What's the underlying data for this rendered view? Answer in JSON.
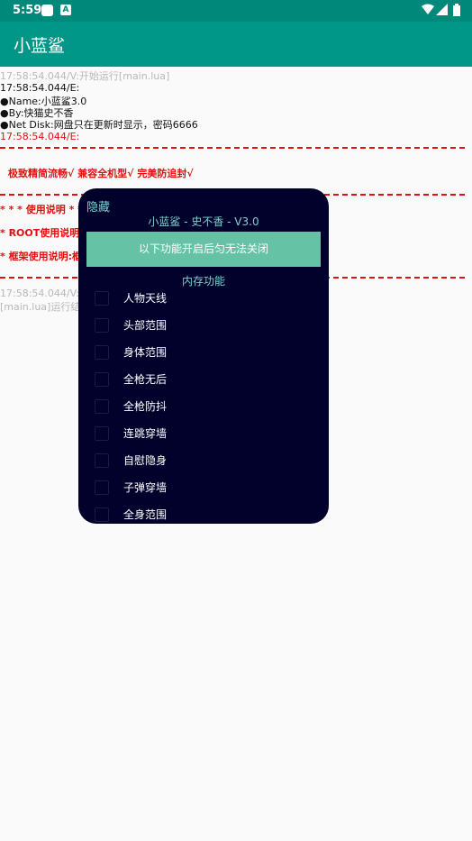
{
  "status_bar": {
    "time": "5:59",
    "icons": [
      "notification-square-icon",
      "a-icon",
      "wifi-icon",
      "signal-icon",
      "battery-icon"
    ]
  },
  "app": {
    "title": "小蓝鲨"
  },
  "log": {
    "l1": "17:58:54.044/V:开始运行[main.lua]",
    "l2": "17:58:54.044/E:",
    "l3": "●Name:小蓝鲨3.0",
    "l4": "●By:快猫史不香",
    "l5": "●Net Disk:网盘只在更新时显示，密码6666",
    "l6": "17:58:54.044/E:",
    "features": "极致精简流畅√  兼容全机型√  完美防追封√",
    "usage": "* * * 使用说明 * * *",
    "root": "* ROOT使用说明:编",
    "frame": "* 框架使用说明:框",
    "end1": "17:58:54.044/V:",
    "end2": "[main.lua]运行结束"
  },
  "menu": {
    "hide": "隐藏",
    "title": "小蓝鲨 - 史不香 - V3.0",
    "notice": "以下功能开启后匀无法关闭",
    "section": "内存功能",
    "items": [
      "人物天线",
      "头部范围",
      "身体范围",
      "全枪无后",
      "全枪防抖",
      "连跳穿墙",
      "自慰隐身",
      "子弹穿墙",
      "全身范围"
    ]
  },
  "colors": {
    "appbar": "#009688",
    "statusbar": "#00897b",
    "overlay": "#02012b",
    "notice": "#66c2a5",
    "accent_text": "#7fcfcf",
    "log_red": "#e01010"
  }
}
